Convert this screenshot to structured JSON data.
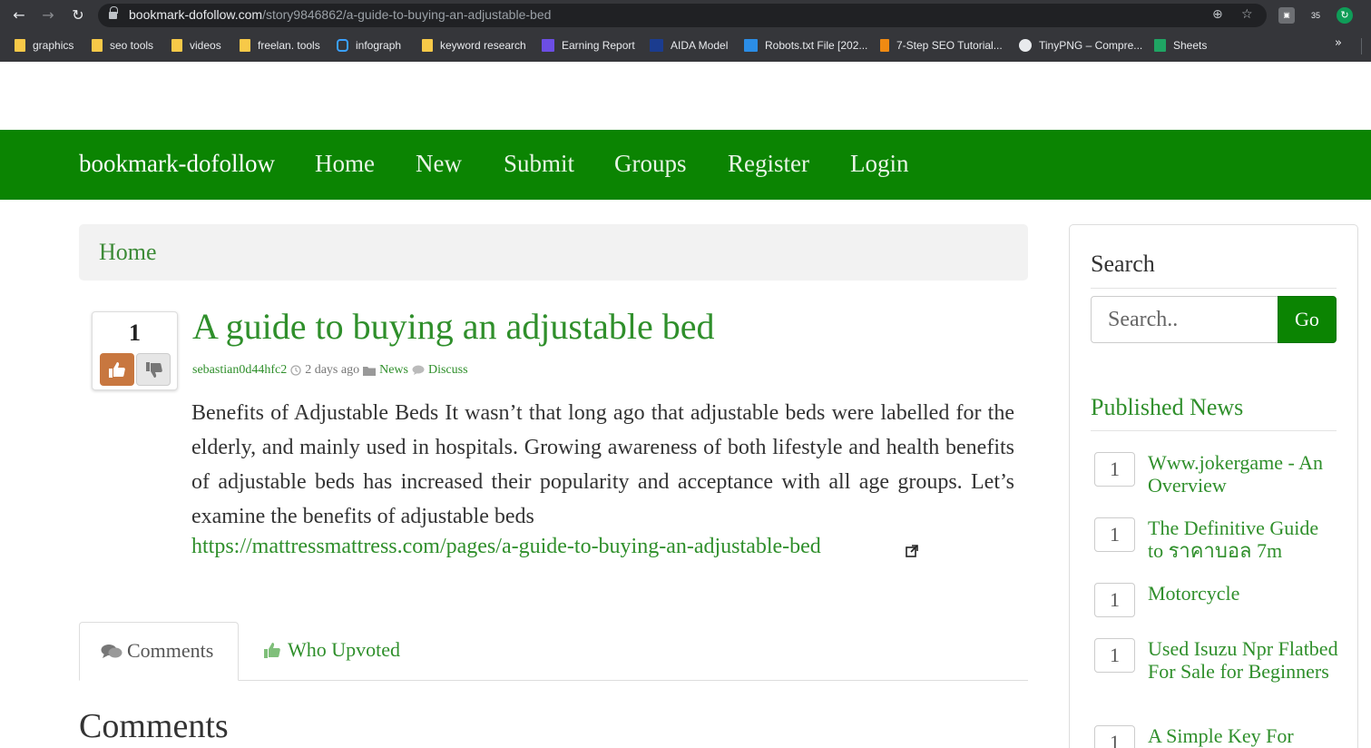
{
  "browser": {
    "url_host": "bookmark-dofollow.com",
    "url_path": "/story9846862/a-guide-to-buying-an-adjustable-bed",
    "extension_badge": "35",
    "bookmarks": [
      {
        "label": "graphics",
        "icon": "folder-icon"
      },
      {
        "label": "seo tools",
        "icon": "folder-icon"
      },
      {
        "label": "videos",
        "icon": "folder-icon"
      },
      {
        "label": "freelan. tools",
        "icon": "folder-icon"
      },
      {
        "label": "infograph",
        "icon": "infograph-icon"
      },
      {
        "label": "keyword research",
        "icon": "folder-icon"
      },
      {
        "label": "Earning Report",
        "icon": "list-icon"
      },
      {
        "label": "AIDA Model",
        "icon": "chart-icon"
      },
      {
        "label": "Robots.txt File [202...",
        "icon": "m-icon"
      },
      {
        "label": "7-Step SEO Tutorial...",
        "icon": "b-icon"
      },
      {
        "label": "TinyPNG – Compre...",
        "icon": "panda-icon"
      },
      {
        "label": "Sheets",
        "icon": "sheets-icon"
      }
    ],
    "more": "»"
  },
  "navbar": {
    "brand": "bookmark-dofollow",
    "links": [
      "Home",
      "New",
      "Submit",
      "Groups",
      "Register",
      "Login"
    ]
  },
  "breadcrumb": "Home",
  "story": {
    "votes": "1",
    "title": "A guide to buying an adjustable bed",
    "author": "sebastian0d44hfc2",
    "time": "2 days ago",
    "category": "News",
    "discuss": "Discuss",
    "body": "Benefits of Adjustable Beds It wasn’t that long ago that adjustable beds were labelled for the elderly, and mainly used in hospitals. Growing awareness of both lifestyle and health benefits of adjustable beds has increased their popularity and acceptance with all age groups. Let’s examine the benefits of adjustable beds",
    "link": "https://mattressmattress.com/pages/a-guide-to-buying-an-adjustable-bed"
  },
  "tabs": {
    "comments": "Comments",
    "who_upvoted": "Who Upvoted"
  },
  "comments_heading": "Comments",
  "sidebar": {
    "search_heading": "Search",
    "search_placeholder": "Search..",
    "go_label": "Go",
    "news_heading": "Published News",
    "news": [
      {
        "count": "1",
        "title": "Www.jokergame - An Overview"
      },
      {
        "count": "1",
        "title": "The Definitive Guide to ราคาบอล 7m"
      },
      {
        "count": "1",
        "title": "Motorcycle"
      },
      {
        "count": "1",
        "title": "Used Isuzu Npr Flatbed For Sale for Beginners"
      },
      {
        "count": "1",
        "title": "A Simple Key For"
      }
    ]
  },
  "colors": {
    "brand_green": "#0b8402",
    "link_green": "#2f8f2b",
    "upvote": "#c8773f"
  }
}
